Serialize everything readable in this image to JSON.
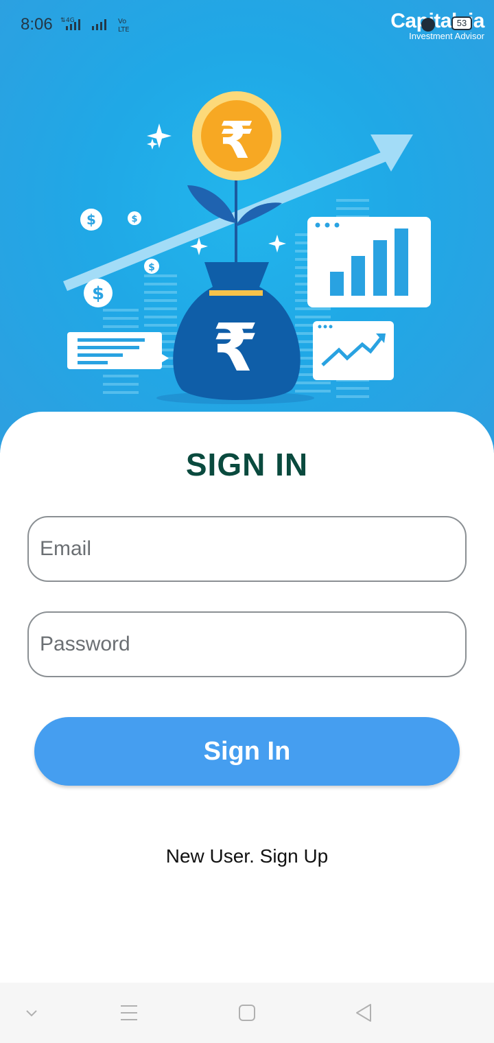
{
  "status_bar": {
    "time": "8:06",
    "network": "4G",
    "volte": "Vo LTE",
    "battery": "53"
  },
  "brand": {
    "name": "Capitalvia",
    "tagline": "Investment Advisor"
  },
  "illustration": {
    "description_icons": [
      "rupee-coin-icon",
      "money-bag-icon",
      "growth-arrow-icon",
      "bar-chart-icon",
      "line-chart-icon",
      "dollar-icon",
      "sparkle-icon"
    ]
  },
  "signin": {
    "title": "SIGN IN",
    "email_placeholder": "Email",
    "password_placeholder": "Password",
    "button_label": "Sign In",
    "signup_link": "New User. Sign Up"
  },
  "nav": {
    "items": [
      "chevron-down-icon",
      "menu-icon",
      "home-square-icon",
      "back-triangle-icon"
    ]
  },
  "colors": {
    "hero_blue": "#20a8e6",
    "title_green": "#0a4a3e",
    "button_blue": "#459ef0"
  }
}
